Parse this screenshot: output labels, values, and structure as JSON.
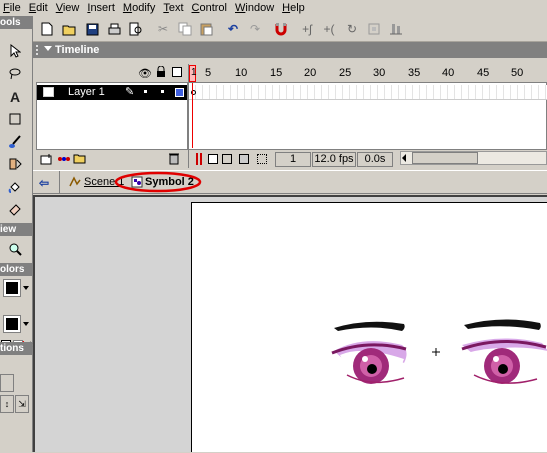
{
  "menu": [
    {
      "label": "File",
      "mnemonic": "F",
      "rest": "ile"
    },
    {
      "label": "Edit",
      "mnemonic": "E",
      "rest": "dit"
    },
    {
      "label": "View",
      "mnemonic": "V",
      "rest": "iew"
    },
    {
      "label": "Insert",
      "mnemonic": "I",
      "rest": "nsert"
    },
    {
      "label": "Modify",
      "mnemonic": "M",
      "rest": "odify"
    },
    {
      "label": "Text",
      "mnemonic": "T",
      "rest": "ext"
    },
    {
      "label": "Control",
      "mnemonic": "C",
      "rest": "ontrol"
    },
    {
      "label": "Window",
      "mnemonic": "W",
      "rest": "indow"
    },
    {
      "label": "Help",
      "mnemonic": "H",
      "rest": "elp"
    }
  ],
  "tools_panel": {
    "header": "ools",
    "view_header": "iew",
    "colors_header": "olors",
    "options_header": "tions"
  },
  "timeline": {
    "title": "Timeline",
    "layer_name": "Layer 1",
    "ruler_labels": [
      "1",
      "5",
      "10",
      "15",
      "20",
      "25",
      "30",
      "35",
      "40",
      "45",
      "50"
    ],
    "current_frame": "1",
    "frame_rate": "12.0 fps",
    "elapsed": "0.0s"
  },
  "editbar": {
    "scene_label": "Scene 1",
    "symbol_label": "Symbol 2",
    "highlight_color": "#e00000"
  },
  "colors": {
    "eye_purple": "#a02a7a",
    "eye_pink": "#e8a0d8",
    "brow": "#111111"
  }
}
